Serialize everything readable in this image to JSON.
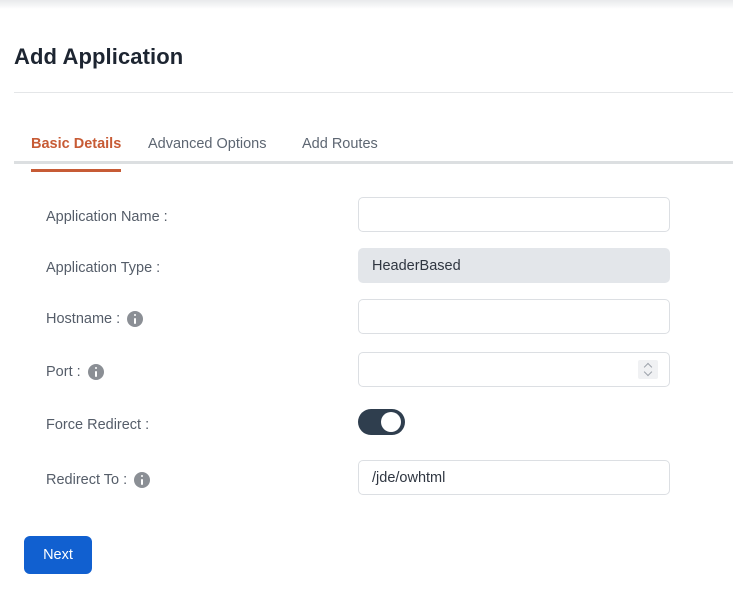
{
  "header": {
    "title": "Add Application"
  },
  "tabs": [
    {
      "label": "Basic Details",
      "active": true
    },
    {
      "label": "Advanced Options",
      "active": false
    },
    {
      "label": "Add Routes",
      "active": false
    }
  ],
  "form": {
    "fields": [
      {
        "label": "Application Name :",
        "value": "",
        "placeholder": "",
        "control": "text",
        "has_info_icon": false,
        "disabled": false
      },
      {
        "label": "Application Type :",
        "value": "HeaderBased",
        "placeholder": "",
        "control": "text",
        "has_info_icon": false,
        "disabled": true
      },
      {
        "label": "Hostname :",
        "value": "",
        "placeholder": "",
        "control": "text",
        "has_info_icon": true,
        "disabled": false
      },
      {
        "label": "Port :",
        "value": "",
        "placeholder": "",
        "control": "number",
        "has_info_icon": true,
        "disabled": false
      },
      {
        "label": "Force Redirect :",
        "value": "on",
        "control": "toggle",
        "has_info_icon": false,
        "disabled": false
      },
      {
        "label": "Redirect To :",
        "value": "/jde/owhtml",
        "placeholder": "",
        "control": "text",
        "has_info_icon": true,
        "disabled": false
      }
    ]
  },
  "actions": {
    "next_label": "Next"
  },
  "icons": {
    "info": "info-icon",
    "spinner_up": "chevron-up-icon",
    "spinner_down": "chevron-down-icon"
  },
  "colors": {
    "accent_tab": "#c75b35",
    "primary_button": "#1160d0",
    "toggle_on": "#2f3e4e",
    "title": "#1d2531",
    "disabled_field": "#e3e6ea"
  }
}
